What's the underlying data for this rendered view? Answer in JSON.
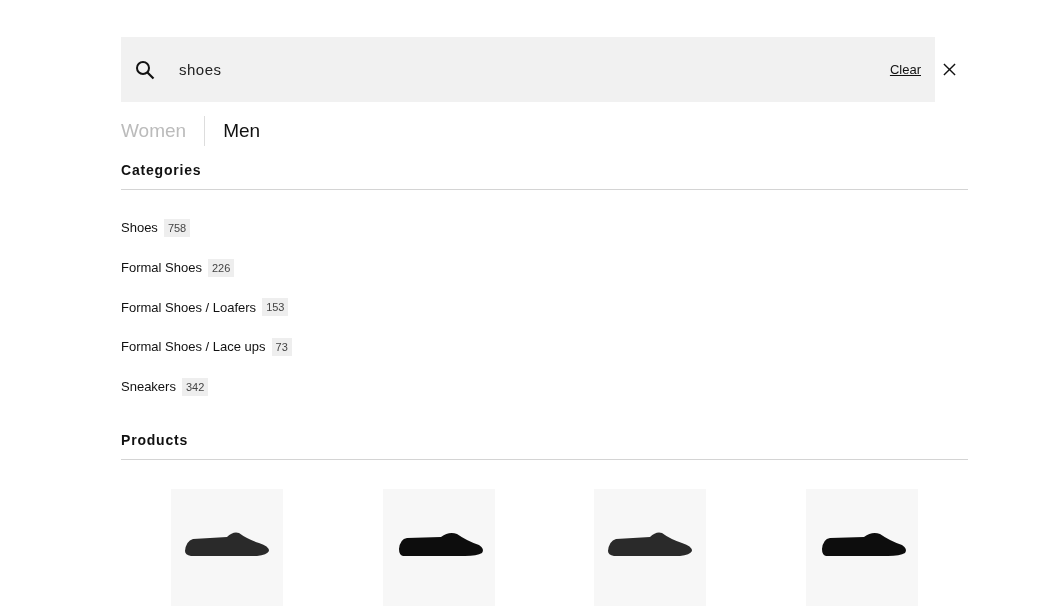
{
  "search": {
    "value": "shoes",
    "clear_label": "Clear"
  },
  "tabs": [
    {
      "label": "Women",
      "selected": false
    },
    {
      "label": "Men",
      "selected": true
    }
  ],
  "categories": {
    "title": "Categories",
    "items": [
      {
        "label": "Shoes",
        "count": "758"
      },
      {
        "label": "Formal Shoes",
        "count": "226"
      },
      {
        "label": "Formal Shoes / Loafers",
        "count": "153"
      },
      {
        "label": "Formal Shoes / Lace ups",
        "count": "73"
      },
      {
        "label": "Sneakers",
        "count": "342"
      }
    ]
  },
  "products": {
    "title": "Products",
    "items": [
      {
        "kind": "loafer"
      },
      {
        "kind": "lace-up"
      },
      {
        "kind": "loafer"
      },
      {
        "kind": "lace-up"
      }
    ]
  }
}
